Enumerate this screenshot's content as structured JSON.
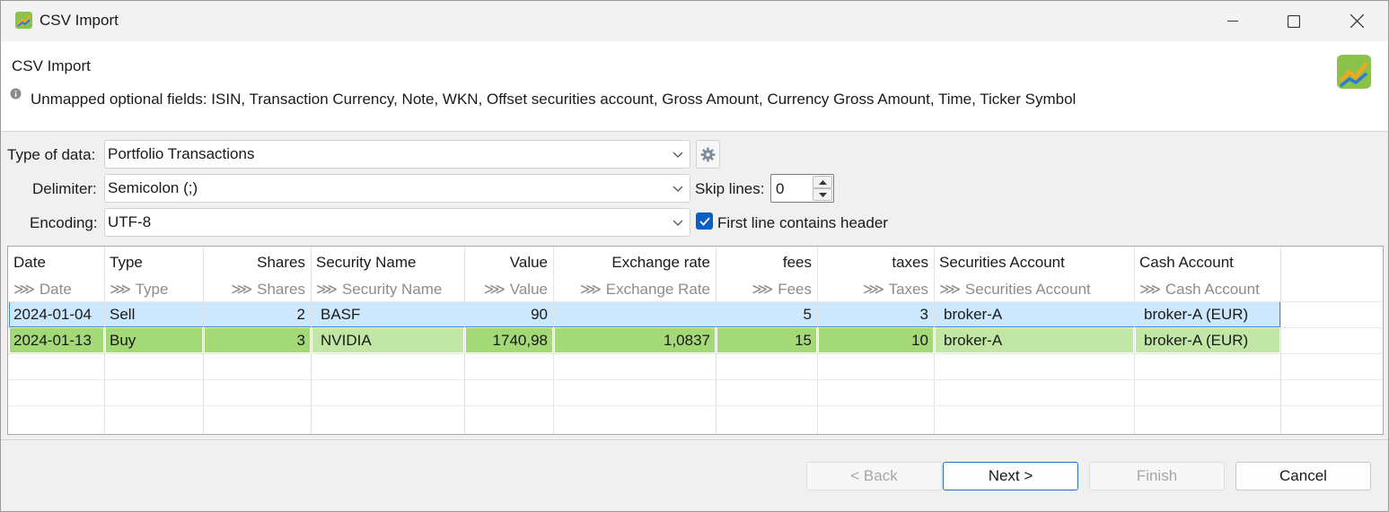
{
  "window": {
    "title": "CSV Import"
  },
  "header": {
    "title": "CSV Import",
    "message": "Unmapped optional fields: ISIN, Transaction Currency, Note, WKN, Offset securities account, Gross Amount, Currency Gross Amount, Time, Ticker Symbol"
  },
  "form": {
    "type_label": "Type of data:",
    "type_value": "Portfolio Transactions",
    "delimiter_label": "Delimiter:",
    "delimiter_value": "Semicolon (;)",
    "encoding_label": "Encoding:",
    "encoding_value": "UTF-8",
    "skip_label": "Skip lines:",
    "skip_value": "0",
    "header_checkbox_label": "First line contains header",
    "header_checkbox_checked": true
  },
  "table": {
    "columns": [
      {
        "header": "Date",
        "mapping": "⋙ Date"
      },
      {
        "header": "Type",
        "mapping": "⋙ Type"
      },
      {
        "header": "Shares",
        "mapping": "⋙ Shares"
      },
      {
        "header": "Security Name",
        "mapping": "⋙ Security Name"
      },
      {
        "header": "Value",
        "mapping": "⋙ Value"
      },
      {
        "header": "Exchange rate",
        "mapping": "⋙ Exchange Rate"
      },
      {
        "header": "fees",
        "mapping": "⋙ Fees"
      },
      {
        "header": "taxes",
        "mapping": "⋙ Taxes"
      },
      {
        "header": "Securities Account",
        "mapping": "⋙ Securities Account"
      },
      {
        "header": "Cash Account",
        "mapping": "⋙ Cash Account"
      }
    ],
    "rows": [
      [
        "2024-01-04",
        "Sell",
        "2",
        "BASF",
        "90",
        "",
        "5",
        "3",
        "broker-A",
        "broker-A (EUR)"
      ],
      [
        "2024-01-13",
        "Buy",
        "3",
        "NVIDIA",
        "1740,98",
        "1,0837",
        "15",
        "10",
        "broker-A",
        "broker-A (EUR)"
      ]
    ]
  },
  "buttons": {
    "back": "< Back",
    "next": "Next >",
    "finish": "Finish",
    "cancel": "Cancel"
  },
  "colors": {
    "selected_row": "#cce8ff",
    "valid_row": "#a3d977",
    "valid_row_light": "#c2e6a6",
    "accent": "#0a5fc4"
  }
}
